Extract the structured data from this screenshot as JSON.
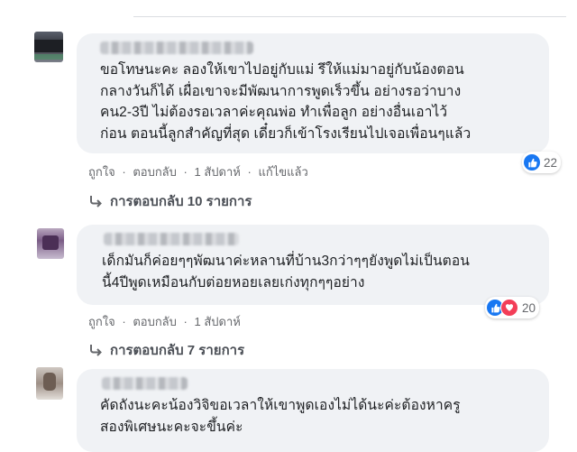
{
  "comments": [
    {
      "text": "ขอโทษนะคะ ลองให้เขาไปอยู่กับแม่ รึให้แม่มาอยู่กับน้องตอน\nกลางวันก็ได้ เผื่อเขาจะมีพัฒนาการพูดเร็วขึ้น อย่างรอว่าบาง\nคน2-3ปี ไม่ต้องรอเวลาค่ะคุณพ่อ ทำเพื่อลูก อย่างอื่นเอาไว้\nก่อน ตอนนี้ลูกสำคัญที่สุด เดี๋ยวก็เข้าโรงเรียนไปเจอเพื่อนๆแล้ว",
      "actions": {
        "like": "ถูกใจ",
        "reply": "ตอบกลับ",
        "time": "1 สัปดาห์",
        "edited": "แก้ไขแล้ว",
        "sep": "·"
      },
      "reactions": {
        "count": "22",
        "icons": [
          "like-icon"
        ]
      },
      "replies": "การตอบกลับ 10 รายการ"
    },
    {
      "text": "เด็กมันก็ค่อยๆๆพัฒนาค่ะหลานที่บ้าน3กว่าๆๆยังพูดไม่เป็นตอน\nนี้4ปีพูดเหมือนกับต่อยหอยเลยเก่งทุกๆๆอย่าง",
      "actions": {
        "like": "ถูกใจ",
        "reply": "ตอบกลับ",
        "time": "1 สัปดาห์",
        "sep": "·"
      },
      "reactions": {
        "count": "20",
        "icons": [
          "like-icon",
          "love-icon"
        ]
      },
      "replies": "การตอบกลับ 7 รายการ"
    },
    {
      "text": "คัดถังนะคะน้องวิจิขอเวลาให้เขาพูดเองไม่ได้นะค่ะต้องหาครู\nสองพิเศษนะคะจะขึ้นค่ะ"
    }
  ],
  "colors": {
    "bubble": "#f0f2f5",
    "like": "#1877f2",
    "love": "#f33e58",
    "meta": "#65676b"
  }
}
